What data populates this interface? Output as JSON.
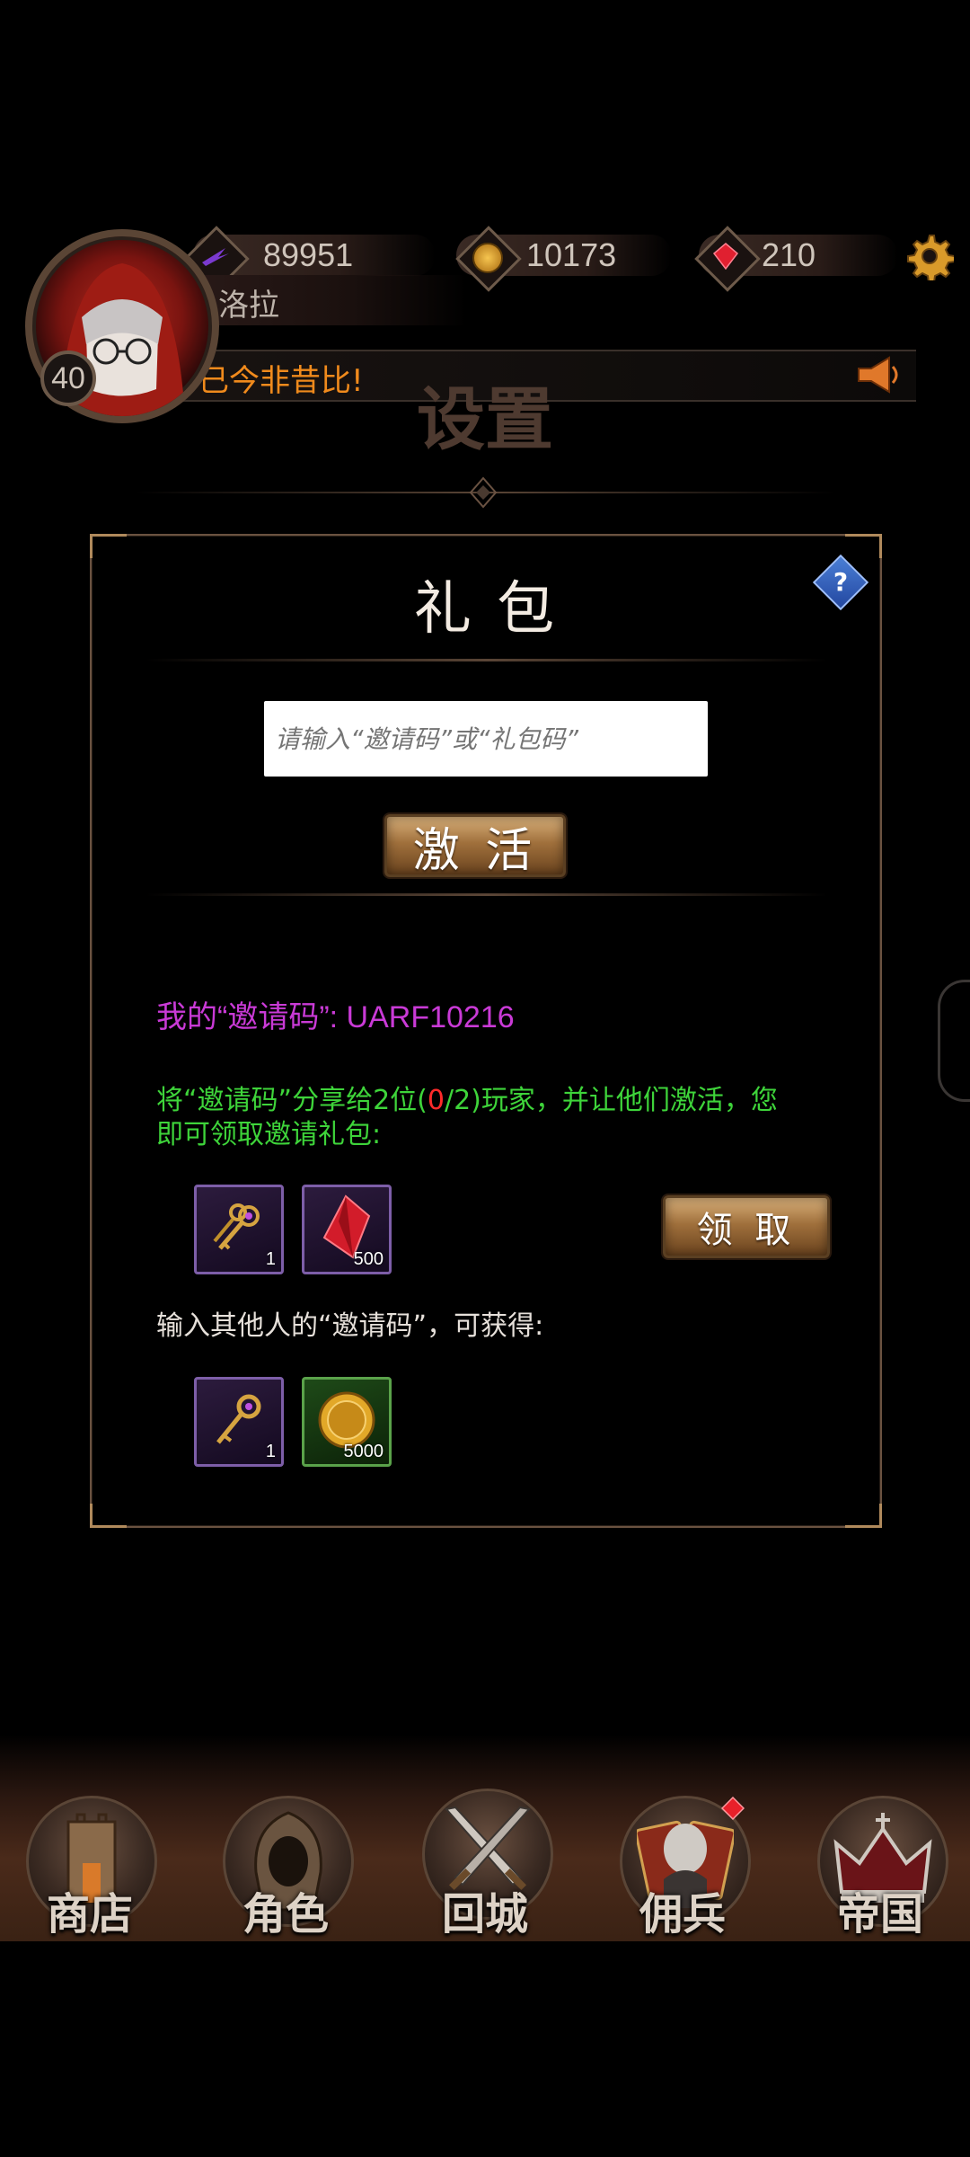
{
  "hud": {
    "power": "89951",
    "gold": "10173",
    "gems": "210",
    "player_name": "洛拉",
    "level": "40",
    "notice": "实力已今非昔比!"
  },
  "page_title": "设置",
  "dialog": {
    "title": "礼 包",
    "help": "?",
    "code_input_placeholder": "请输入“邀请码”或“礼包码”",
    "activate_label": "激 活",
    "my_code_text": "我的“邀请码”: UARF10216",
    "share_text_prefix": "将“邀请码”分享给2位(",
    "share_progress": "0",
    "share_text_suffix": "/2)玩家，并让他们激活，您即可领取邀请礼包:",
    "claim_label": "领 取",
    "invite_rewards": [
      {
        "icon": "golden-keys-icon",
        "count": "1"
      },
      {
        "icon": "red-gem-icon",
        "count": "500"
      }
    ],
    "others_text": "输入其他人的“邀请码”，可获得:",
    "others_rewards": [
      {
        "icon": "golden-key-icon",
        "count": "1"
      },
      {
        "icon": "gold-coin-icon",
        "count": "5000"
      }
    ]
  },
  "nav": [
    {
      "label": "商店",
      "icon": "castle-tower-icon"
    },
    {
      "label": "角色",
      "icon": "hooded-figure-icon"
    },
    {
      "label": "回城",
      "icon": "crossed-swords-icon"
    },
    {
      "label": "佣兵",
      "icon": "mercenary-cards-icon"
    },
    {
      "label": "帝国",
      "icon": "crown-icon"
    }
  ],
  "colors": {
    "invite_code": "#c93ad6",
    "share_text": "#3ed43a",
    "share_progress": "#ff2a2a",
    "notice": "#f08a1c"
  }
}
